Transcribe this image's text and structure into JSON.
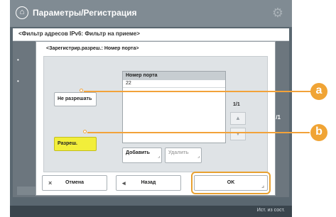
{
  "topbar": {
    "title": "Параметры/Регистрация"
  },
  "breadcrumb": "<Фильтр адресов IPv6: Фильтр на приеме>",
  "background_page": {
    "page": "1/1"
  },
  "dialog": {
    "title": "<Зарегистрир.разреш.: Номер порта>",
    "do_not_allow_label": "Не разрешать",
    "allow_label": "Разреш.",
    "list_header": "Номер порта",
    "list_items": [
      "22"
    ],
    "page_indicator": "1/1",
    "add_label": "Добавить",
    "delete_label": "Удалить"
  },
  "footer": {
    "cancel_label": "Отмена",
    "back_label": "Назад",
    "ok_label": "OK"
  },
  "status": {
    "text": "Ист. из сост."
  },
  "callouts": {
    "a": "a",
    "b": "b"
  },
  "colors": {
    "selected": "#f2ee3a",
    "accent": "#f0a435",
    "ok_ring": "#e8a131"
  }
}
